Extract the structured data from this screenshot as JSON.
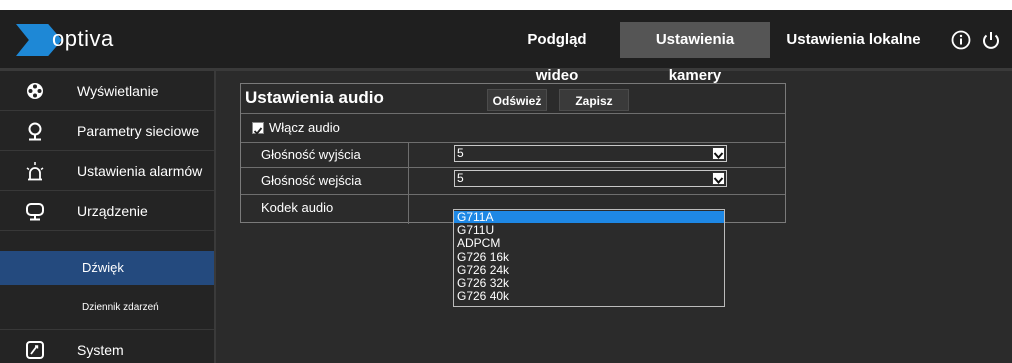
{
  "header": {
    "logo_text": "optiva",
    "nav": [
      {
        "label": "Podgląd wideo"
      },
      {
        "label": "Ustawienia kamery"
      },
      {
        "label": "Ustawienia lokalne"
      }
    ],
    "icons": [
      "info-icon",
      "power-icon"
    ],
    "colors": {
      "brand": "#1e88d6",
      "active_tab": "#555555"
    }
  },
  "sidebar": {
    "items": [
      {
        "label": "Wyświetlanie",
        "icon": "display-icon"
      },
      {
        "label": "Parametry sieciowe",
        "icon": "network-pin-icon"
      },
      {
        "label": "Ustawienia alarmów",
        "icon": "alarm-light-icon"
      },
      {
        "label": "Urządzenie",
        "icon": "device-icon"
      },
      {
        "label": "System",
        "icon": "system-icon"
      }
    ],
    "subitems": [
      {
        "label": "Dźwięk"
      },
      {
        "label": "Dziennik zdarzeń"
      }
    ],
    "active_color": "#244a7e"
  },
  "panel": {
    "title": "Ustawienia audio",
    "refresh_label": "Odśwież",
    "save_label": "Zapisz",
    "enable_audio_label": "Włącz audio",
    "enable_audio_checked": true,
    "output_volume_label": "Głośność wyjścia",
    "output_volume_value": "5",
    "input_volume_label": "Głośność wejścia",
    "input_volume_value": "5",
    "codec_label": "Kodek audio"
  },
  "codec_dropdown": {
    "selected": "G711A",
    "options": [
      "G711A",
      "G711U",
      "ADPCM",
      "G726 16k",
      "G726 24k",
      "G726 32k",
      "G726 40k"
    ],
    "highlight_color": "#1e88e5"
  }
}
